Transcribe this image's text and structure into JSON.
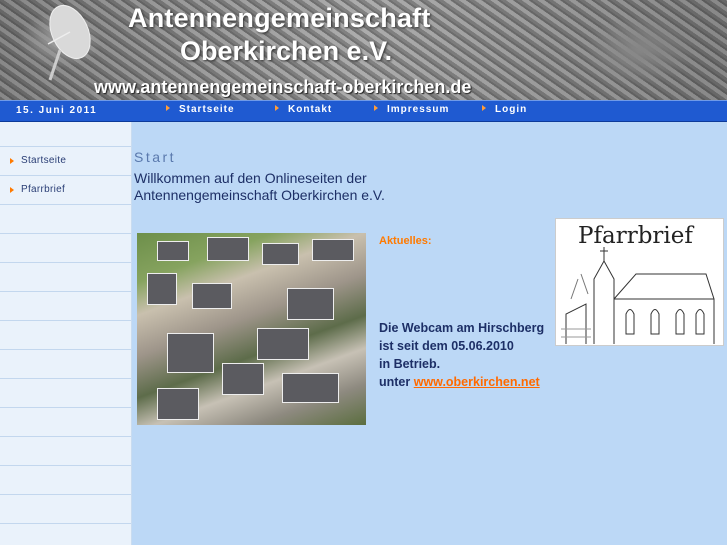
{
  "header": {
    "title_line1": "Antennengemeinschaft",
    "title_line2": "Oberkirchen e.V.",
    "url": "www.antennengemeinschaft-oberkirchen.de"
  },
  "navbar": {
    "date": "15. Juni 2011",
    "items": [
      {
        "label": "Startseite"
      },
      {
        "label": "Kontakt"
      },
      {
        "label": "Impressum"
      },
      {
        "label": "Login"
      }
    ]
  },
  "sidebar": {
    "items": [
      {
        "label": "Startseite"
      },
      {
        "label": "Pfarrbrief"
      }
    ]
  },
  "main": {
    "heading": "Start",
    "welcome": "Willkommen auf den Onlineseiten der Antennengemeinschaft Oberkirchen e.V.",
    "aktuelles": "Aktuelles:",
    "webcam_line1": "Die Webcam am Hirschberg",
    "webcam_line2": "ist seit dem 05.06.2010",
    "webcam_line3": "in Betrieb.",
    "webcam_prefix": "unter",
    "webcam_link": "www.oberkirchen.net",
    "pfarrbrief_image_title": "Pfarrbrief"
  },
  "colors": {
    "nav_bar": "#1f5ad1",
    "accent_orange": "#ff7a00",
    "page_bg": "#bcd8f6"
  }
}
